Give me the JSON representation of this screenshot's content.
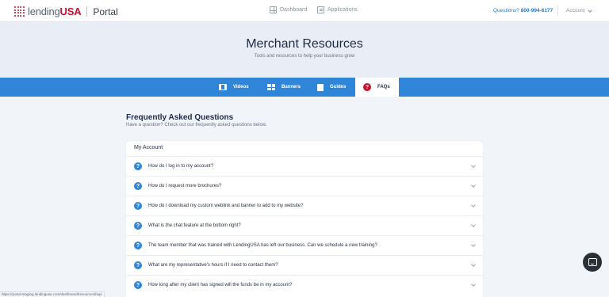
{
  "brand": {
    "name_prefix": "lending",
    "name_suffix": "USA",
    "portal": "Portal"
  },
  "topnav": {
    "dashboard": "Dashboard",
    "applications": "Applications"
  },
  "questions": {
    "label": "Questions?",
    "phone": "800-994-6177"
  },
  "account": {
    "label": "Account"
  },
  "hero": {
    "title": "Merchant Resources",
    "subtitle": "Tools and resources to help your business grow"
  },
  "tabs": [
    {
      "label": "Videos",
      "icon": "film-icon"
    },
    {
      "label": "Banners",
      "icon": "grid-icon"
    },
    {
      "label": "Guides",
      "icon": "book-icon"
    },
    {
      "label": "FAQs",
      "icon": "question-circle-icon",
      "active": true
    }
  ],
  "faq": {
    "title": "Frequently Asked Questions",
    "subtitle": "Have a question? Check out our frequently asked questions below.",
    "section_title": "My Account",
    "items": [
      "How do I log in to my account?",
      "How do I request more brochures?",
      "How do I download my custom weblink and banner to add to my website?",
      "What is the chat feature at the bottom right?",
      "The team member that was trained with LendingUSA has left our business. Can we schedule a new training?",
      "What are my representative's hours if I need to contact them?",
      "How long after my client has signed will the funds be in my account?"
    ]
  },
  "status_url": "https://portal.staging.lendingusa.com/dashboard/resources/faqs",
  "colors": {
    "brand_red": "#c8102e",
    "accent_blue": "#2f86d9",
    "hero_bg": "#e9eef6"
  }
}
